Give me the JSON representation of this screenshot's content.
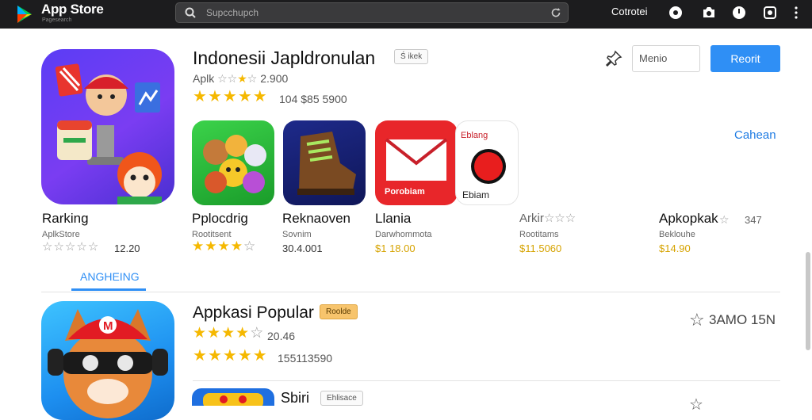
{
  "topbar": {
    "brand": "App Store",
    "brand_sub": "Pagesearch",
    "search_text": "Supcchupch",
    "account": "Cotrotei"
  },
  "featured": {
    "title": "Indonesii Japldronulan",
    "badge": "Ś ikek",
    "rating_text": "Aplk",
    "rating_count": "2.900",
    "rating_count2": "104 $85 5900",
    "search_field": "Menio",
    "primary_button": "Reorit",
    "see_all": "Cahean",
    "icon_caption": "Rarking",
    "icon_dev": "AplkStore",
    "icon_meta": "12.20",
    "icon_rating": 0
  },
  "tiles": [
    {
      "name": "Pplocdrig",
      "dev": "Rootitsent",
      "price": "",
      "meta": "",
      "stars": 4
    },
    {
      "name": "Reknaoven",
      "dev": "Sovnim",
      "price": "",
      "meta": "30.4.001",
      "stars": 0
    },
    {
      "name": "Llania",
      "dev": "Darwhommota",
      "price": "$1 18.00",
      "meta": "",
      "stars": 0,
      "icon_label": "Porobiam"
    },
    {
      "name": "Ebiam",
      "dev": "Rootitams",
      "price": "$11.5060",
      "meta": "",
      "stars": 0,
      "icon_label": "Eblang",
      "rating_label": "Arkir"
    },
    {
      "name": "Apkopkak",
      "dev": "Beklouhe",
      "price": "$14.90",
      "meta": "347",
      "stars": 0
    }
  ],
  "tab": "ANGHEING",
  "popular": {
    "title": "Appkasi Popular",
    "badge": "Roolde",
    "rating_count": "20.46",
    "rating_count2": "155113590",
    "right_meta": "3AMO 15N",
    "second_title": "Sbiri",
    "second_badge": "Ehlisace"
  },
  "colors": {
    "accent": "#2f8ff5",
    "star": "#f5b800",
    "price": "#d6a300",
    "topbar": "#1c1c1e"
  }
}
